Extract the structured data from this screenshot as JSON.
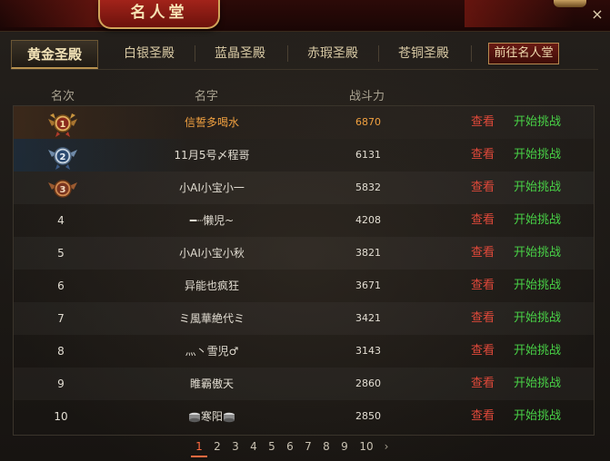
{
  "window": {
    "title": "名人堂",
    "close_symbol": "×"
  },
  "tabs": [
    {
      "label": "黄金圣殿",
      "active": true
    },
    {
      "label": "白银圣殿",
      "active": false
    },
    {
      "label": "蓝晶圣殿",
      "active": false
    },
    {
      "label": "赤瑕圣殿",
      "active": false
    },
    {
      "label": "苍铜圣殿",
      "active": false
    }
  ],
  "hall_button": "前往名人堂",
  "columns": {
    "rank": "名次",
    "name": "名字",
    "power": "战斗力"
  },
  "rows": [
    {
      "rank": "1",
      "name": "信誓多喝水",
      "power": "6870",
      "view": "查看",
      "fight": "开始挑战",
      "medal": "gold"
    },
    {
      "rank": "2",
      "name": "11月5号〆程哥",
      "power": "6131",
      "view": "查看",
      "fight": "开始挑战",
      "medal": "silver"
    },
    {
      "rank": "3",
      "name": "小AI小宝小一",
      "power": "5832",
      "view": "查看",
      "fight": "开始挑战",
      "medal": "bronze"
    },
    {
      "rank": "4",
      "name": "━┈懒児~",
      "power": "4208",
      "view": "查看",
      "fight": "开始挑战"
    },
    {
      "rank": "5",
      "name": "小AI小宝小秋",
      "power": "3821",
      "view": "查看",
      "fight": "开始挑战"
    },
    {
      "rank": "6",
      "name": "异能也疯狂",
      "power": "3671",
      "view": "查看",
      "fight": "开始挑战"
    },
    {
      "rank": "7",
      "name": "ミ風華絶代ミ",
      "power": "3421",
      "view": "查看",
      "fight": "开始挑战"
    },
    {
      "rank": "8",
      "name": "灬丶雪児♂",
      "power": "3143",
      "view": "查看",
      "fight": "开始挑战"
    },
    {
      "rank": "9",
      "name": "睢霸傲天",
      "power": "2860",
      "view": "查看",
      "fight": "开始挑战"
    },
    {
      "rank": "10",
      "name": "寒阳",
      "power": "2850",
      "view": "查看",
      "fight": "开始挑战"
    }
  ],
  "pagination": {
    "pages": [
      "1",
      "2",
      "3",
      "4",
      "5",
      "6",
      "7",
      "8",
      "9",
      "10"
    ],
    "current": "1",
    "next": "›"
  },
  "colors": {
    "view": "#e0493a",
    "fight": "#48d046",
    "top_name": "#f0a040",
    "current_page": "#ff6a40"
  }
}
